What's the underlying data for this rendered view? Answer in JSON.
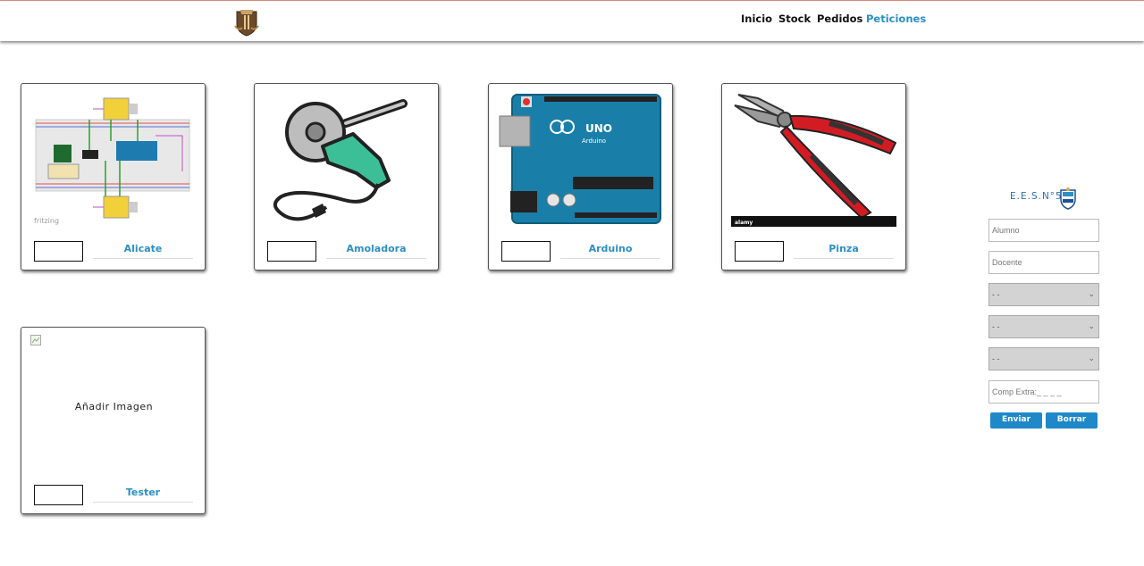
{
  "header": {
    "logo_icon": "school-crest-icon",
    "nav": [
      {
        "label": "Inicio"
      },
      {
        "label": "Stock"
      },
      {
        "label": "Pedidos"
      },
      {
        "label": "Peticiones"
      }
    ],
    "active_color": "#2d8fc4"
  },
  "products": [
    {
      "name": "Alicate",
      "image": "fritzing-circuit-diagram",
      "image_caption": "fritzing"
    },
    {
      "name": "Amoladora",
      "image": "angle-grinder-icon"
    },
    {
      "name": "Arduino",
      "image": "arduino-uno-board",
      "board_label": "UNO",
      "board_brand": "Arduino"
    },
    {
      "name": "Pinza",
      "image": "pliers-photo",
      "watermark": "alamy"
    },
    {
      "name": "Tester",
      "image": "broken-image-icon",
      "placeholder": "Añadir Imagen"
    }
  ],
  "form": {
    "school_name": "E.E.S.N°5",
    "alumno_placeholder": "Alumno",
    "docente_placeholder": "Docente",
    "select1": "- -",
    "select2": "- -",
    "select3": "- -",
    "comp_placeholder": "Comp Extra:_ _ _ _",
    "submit_label": "Enviar",
    "reset_label": "Borrar",
    "button_color": "#1e88c8"
  }
}
